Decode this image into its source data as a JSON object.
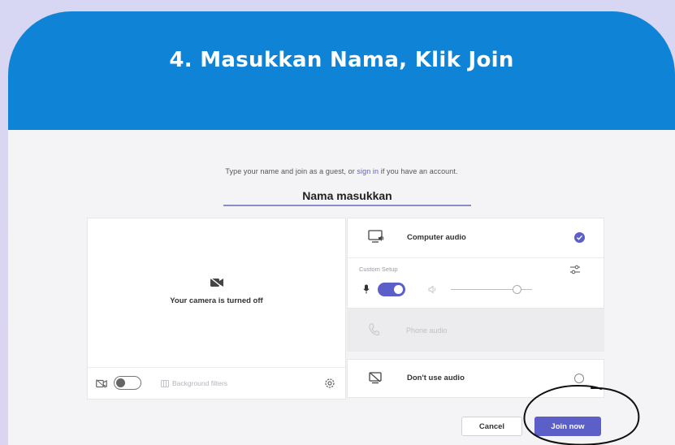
{
  "banner": {
    "title": "4. Masukkan Nama, Klik Join"
  },
  "join_prompt": {
    "before": "Type your name and join as a guest, or ",
    "link": "sign in",
    "after": " if you have an account."
  },
  "name_field": {
    "value": "Nama masukkan"
  },
  "camera": {
    "status_text": "Your camera is turned off",
    "toggle_on": false,
    "background_filters_label": "Background filters"
  },
  "audio": {
    "computer_audio": {
      "label": "Computer audio",
      "selected": true
    },
    "custom_setup_label": "Custom Setup",
    "mic_on": true,
    "volume_level": 0.78,
    "phone_audio": {
      "label": "Phone audio",
      "disabled": true
    },
    "dont_use_audio": {
      "label": "Don't use audio",
      "selected": false
    }
  },
  "actions": {
    "cancel_label": "Cancel",
    "join_label": "Join now"
  },
  "colors": {
    "banner": "#0f84d6",
    "accent": "#5b5fc7",
    "background": "#d7d6f3"
  }
}
